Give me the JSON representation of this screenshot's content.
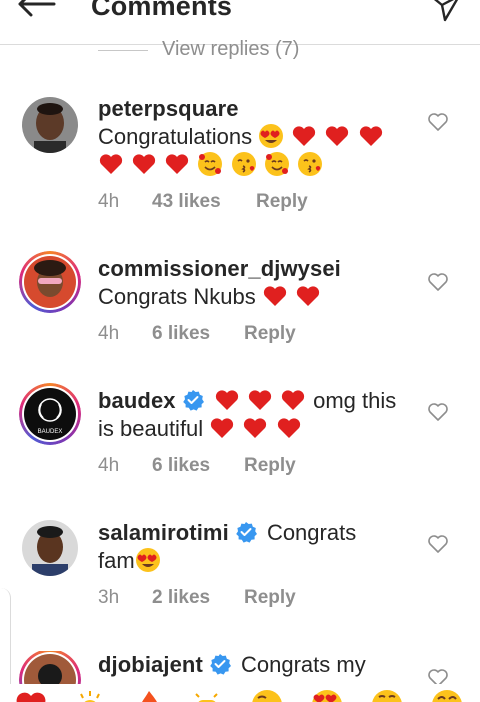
{
  "header": {
    "title": "Comments",
    "back_icon": "arrow-left-icon",
    "send_icon": "paper-plane-icon"
  },
  "view_replies": "View replies (7)",
  "comments": [
    {
      "username": "peterpsquare",
      "text_line1": "Congratulations",
      "time": "4h",
      "likes": "43 likes",
      "reply": "Reply",
      "verified": false
    },
    {
      "username": "commissioner_djwysei",
      "text_line1": "Congrats Nkubs",
      "time": "4h",
      "likes": "6 likes",
      "reply": "Reply",
      "verified": false
    },
    {
      "username": "baudex",
      "text_line1": "omg this",
      "text_line2": "is beautiful",
      "avatar_text": "BAUDEX",
      "time": "4h",
      "likes": "6 likes",
      "reply": "Reply",
      "verified": true
    },
    {
      "username": "salamirotimi",
      "text_line1": "Congrats",
      "text_line2": "fam",
      "time": "3h",
      "likes": "2 likes",
      "reply": "Reply",
      "verified": true
    },
    {
      "username": "djobiajent",
      "text_line1": "Congrats my",
      "verified": true
    }
  ],
  "colors": {
    "heart": "#e0201f",
    "verified": "#3897f0",
    "muted": "#8e8e8e"
  },
  "emoji_bar": [
    "red-heart",
    "clapping",
    "fire",
    "raised-hands",
    "crying-face",
    "heart-eyes",
    "open-mouth",
    "laughing"
  ]
}
